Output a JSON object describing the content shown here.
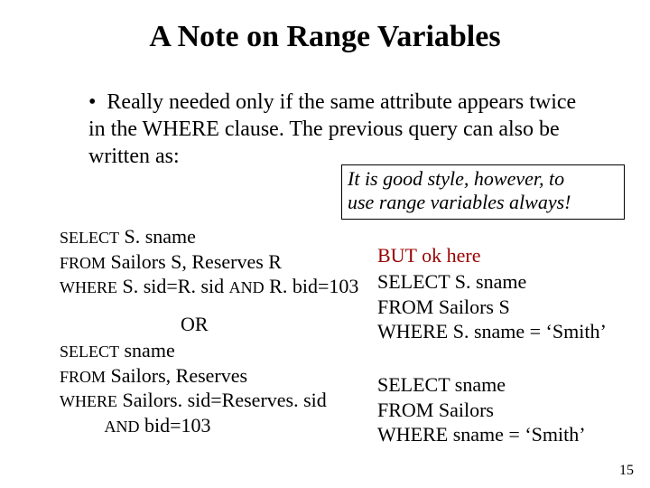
{
  "title": "A Note on Range Variables",
  "bullet_marker": "•",
  "bullet_text": "Really needed only if the same attribute appears twice in the WHERE clause.  The previous query can also be written as:",
  "callout_line1": "It is good style, however, to",
  "callout_line2": "use range variables always!",
  "kw": {
    "select": "SELECT",
    "from": "FROM",
    "where": "WHERE",
    "and": "AND"
  },
  "q1": {
    "select_rest": "  S. sname",
    "from_rest": "     Sailors S, Reserves R",
    "where_rest": "  S. sid=R. sid ",
    "and_rest": " R. bid=103"
  },
  "or_label": "OR",
  "q2": {
    "select_rest": "  sname",
    "from_rest": "     Sailors, Reserves",
    "where_rest": "  Sailors. sid=Reserves. sid",
    "tail_rest": " bid=103"
  },
  "q3": {
    "header": "BUT ok here",
    "l1": "SELECT S. sname",
    "l2": "FROM Sailors S",
    "l3": "WHERE S. sname = ‘Smith’"
  },
  "q4": {
    "l1": "SELECT sname",
    "l2": "FROM Sailors",
    "l3": "WHERE sname = ‘Smith’"
  },
  "page_number": "15"
}
